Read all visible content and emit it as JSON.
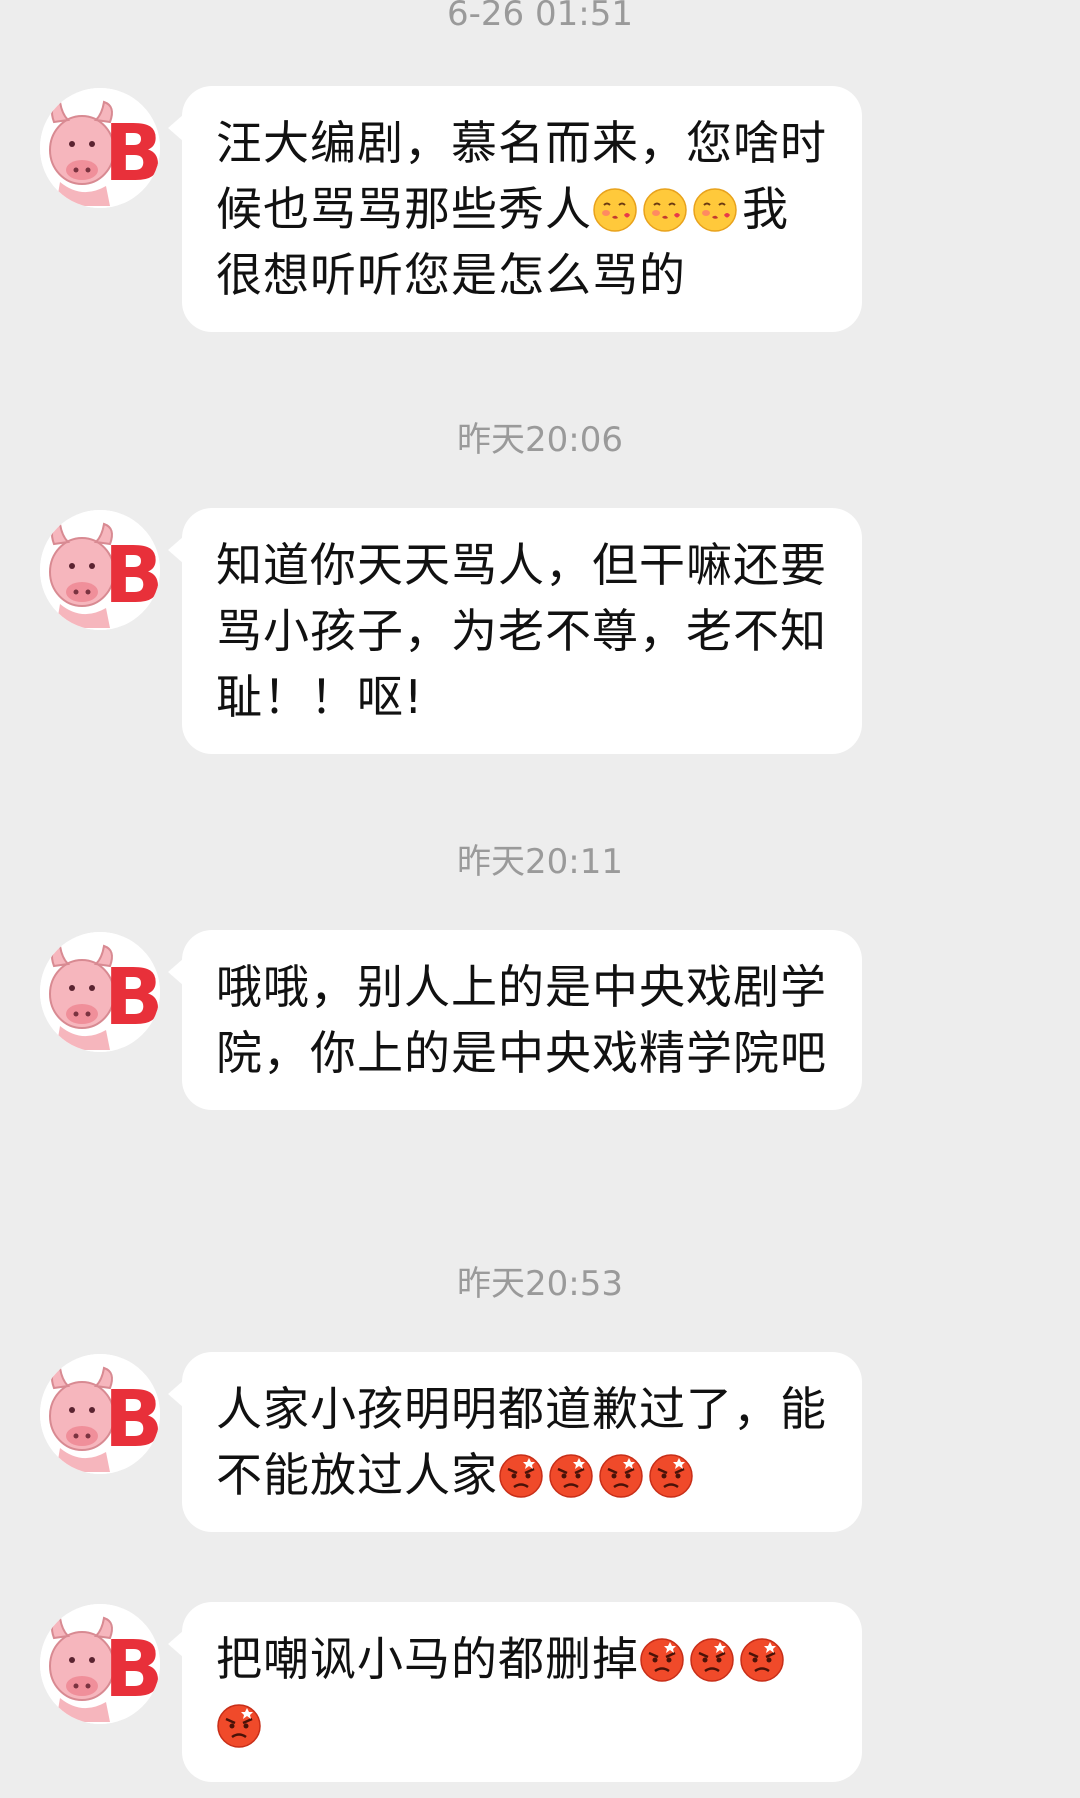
{
  "conversation": {
    "timestamps": [
      "6-26 01:51",
      "昨天20:06",
      "昨天20:11",
      "昨天20:53"
    ],
    "messages": [
      {
        "text": "汪大编剧，慕名而来，您啥时候也骂骂那些秀人",
        "emoji": [
          "blowing-kiss-emoji",
          "blowing-kiss-emoji",
          "blowing-kiss-emoji"
        ],
        "tail": "我很想听听您是怎么骂的"
      },
      {
        "text": "知道你天天骂人，但干嘛还要骂小孩子，为老不尊，老不知耻！！呕!",
        "emoji": [],
        "tail": ""
      },
      {
        "text": "哦哦，别人上的是中央戏剧学院，你上的是中央戏精学院吧",
        "emoji": [],
        "tail": ""
      },
      {
        "text": "人家小孩明明都道歉过了，能不能放过人家",
        "emoji": [
          "angry-face-emoji",
          "angry-face-emoji",
          "angry-face-emoji",
          "angry-face-emoji"
        ],
        "tail": ""
      },
      {
        "text": "把嘲讽小马的都删掉",
        "emoji": [
          "angry-face-emoji",
          "angry-face-emoji",
          "angry-face-emoji",
          "angry-face-emoji"
        ],
        "tail": ""
      }
    ],
    "avatar": {
      "letter": "B",
      "color": "#e8303a",
      "bull_color": "#f2a0a8"
    }
  }
}
